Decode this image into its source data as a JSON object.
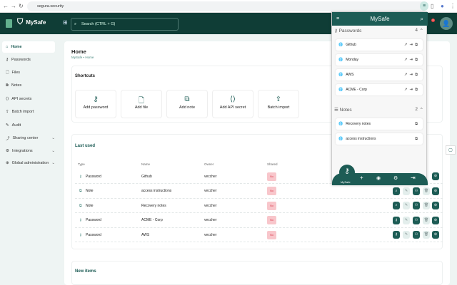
{
  "browser": {
    "url": "segura.security"
  },
  "header": {
    "app_name": "MySafe",
    "search_placeholder": "Search (CTRL + G)",
    "notification_count": "0"
  },
  "sidebar": {
    "items": [
      {
        "label": "Home",
        "icon": "home-icon",
        "active": true
      },
      {
        "label": "Passwords",
        "icon": "key-icon"
      },
      {
        "label": "Files",
        "icon": "file-icon"
      },
      {
        "label": "Notes",
        "icon": "note-icon"
      },
      {
        "label": "API secrets",
        "icon": "code-icon"
      },
      {
        "label": "Batch import",
        "icon": "upload-icon"
      },
      {
        "label": "Audit",
        "icon": "audit-icon"
      },
      {
        "label": "Sharing center",
        "icon": "share-icon",
        "expandable": true
      },
      {
        "label": "Integrations",
        "icon": "integrations-icon",
        "expandable": true
      },
      {
        "label": "Global administration",
        "icon": "globe-icon",
        "expandable": true
      }
    ]
  },
  "page": {
    "title": "Home",
    "breadcrumb": [
      "MySafe",
      "Home"
    ]
  },
  "shortcuts": {
    "title": "Shortcuts",
    "items": [
      {
        "label": "Add password",
        "icon": "key-icon",
        "glyph": "⚷"
      },
      {
        "label": "Add file",
        "icon": "file-icon",
        "glyph": "🗋"
      },
      {
        "label": "Add note",
        "icon": "note-icon",
        "glyph": "⧉"
      },
      {
        "label": "Add API secret",
        "icon": "code-icon",
        "glyph": "⟨⟩"
      },
      {
        "label": "Batch import",
        "icon": "upload-icon",
        "glyph": "⇪"
      }
    ]
  },
  "last_used": {
    "title": "Last used",
    "columns": [
      "Type",
      "Name",
      "Owner",
      "Shared"
    ],
    "rows": [
      {
        "type": "Password",
        "name": "Github",
        "owner": "veccher",
        "shared": "No"
      },
      {
        "type": "Note",
        "name": "access instructions",
        "owner": "veccher",
        "shared": "No"
      },
      {
        "type": "Note",
        "name": "Recovery notes",
        "owner": "veccher",
        "shared": "No"
      },
      {
        "type": "Password",
        "name": "ACME - Corp",
        "owner": "veccher",
        "shared": "No"
      },
      {
        "type": "Password",
        "name": "AWS",
        "owner": "veccher",
        "shared": "No"
      }
    ]
  },
  "new_items": {
    "title": "New items"
  },
  "popup": {
    "title": "MySafe",
    "passwords": {
      "label": "Passwords",
      "count": "4",
      "items": [
        "Github",
        "Monday",
        "AWS",
        "ACME - Corp"
      ]
    },
    "notes": {
      "label": "Notes",
      "count": "2",
      "items": [
        "Recovery notes",
        "access instructions"
      ]
    },
    "bottom_label": "MySafe"
  },
  "colors": {
    "brand_dark": "#0f3d36",
    "accent": "#1d5c55",
    "shared_no_bg": "#f8c6cb"
  }
}
